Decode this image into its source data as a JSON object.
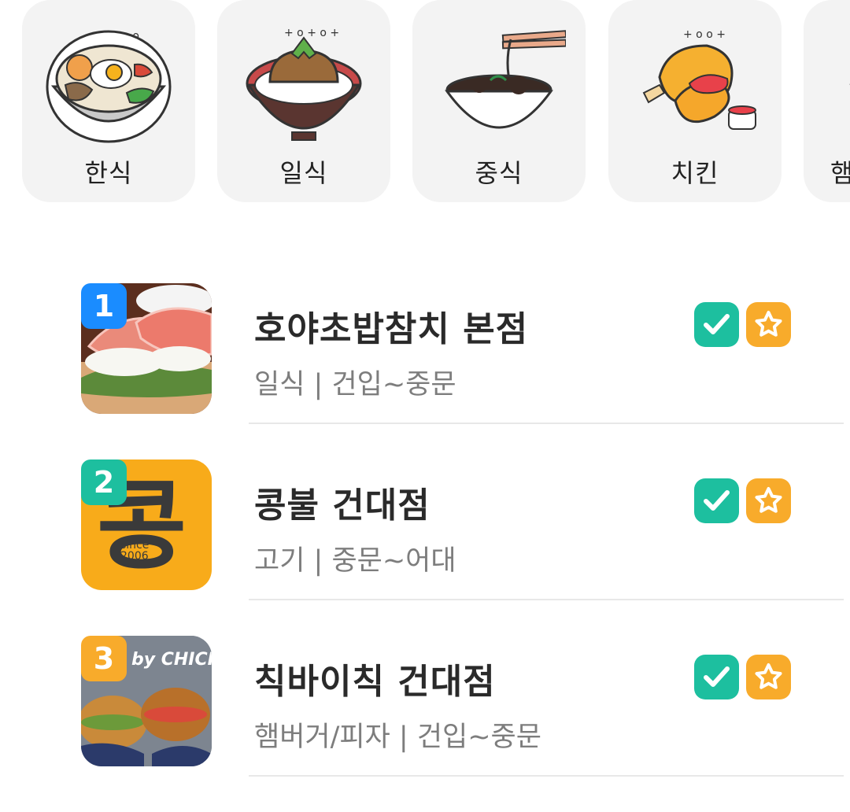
{
  "categories": [
    {
      "label": "한식",
      "icon": "bibimbap-bowl-icon"
    },
    {
      "label": "일식",
      "icon": "donburi-bowl-icon"
    },
    {
      "label": "중식",
      "icon": "noodle-bowl-icon"
    },
    {
      "label": "치킨",
      "icon": "fried-chicken-icon"
    },
    {
      "label": "햄",
      "icon": "burger-icon"
    }
  ],
  "restaurants": [
    {
      "rank": "1",
      "name": "호야초밥참치 본점",
      "sub": "일식  |  건입~중문",
      "rank_color": "#1a8cff",
      "thumb": "sushi-photo"
    },
    {
      "rank": "2",
      "name": "콩불 건대점",
      "sub": "고기 |  중문~어대",
      "rank_color": "#1dbf9f",
      "thumb": "kongbul-logo",
      "logo": {
        "text": "콩불",
        "since": "since",
        "year": "2006"
      }
    },
    {
      "rank": "3",
      "name": "칙바이칙 건대점",
      "sub": "햄버거/피자  |  건입~중문",
      "rank_color": "#f8ab2b",
      "thumb": "chickbychick-photo",
      "logo": {
        "text": "by CHICK"
      }
    }
  ],
  "badges": {
    "check": "check-badge-icon",
    "star": "star-badge-icon",
    "check_color": "#1dbf9f",
    "star_color": "#f8ab2b"
  }
}
